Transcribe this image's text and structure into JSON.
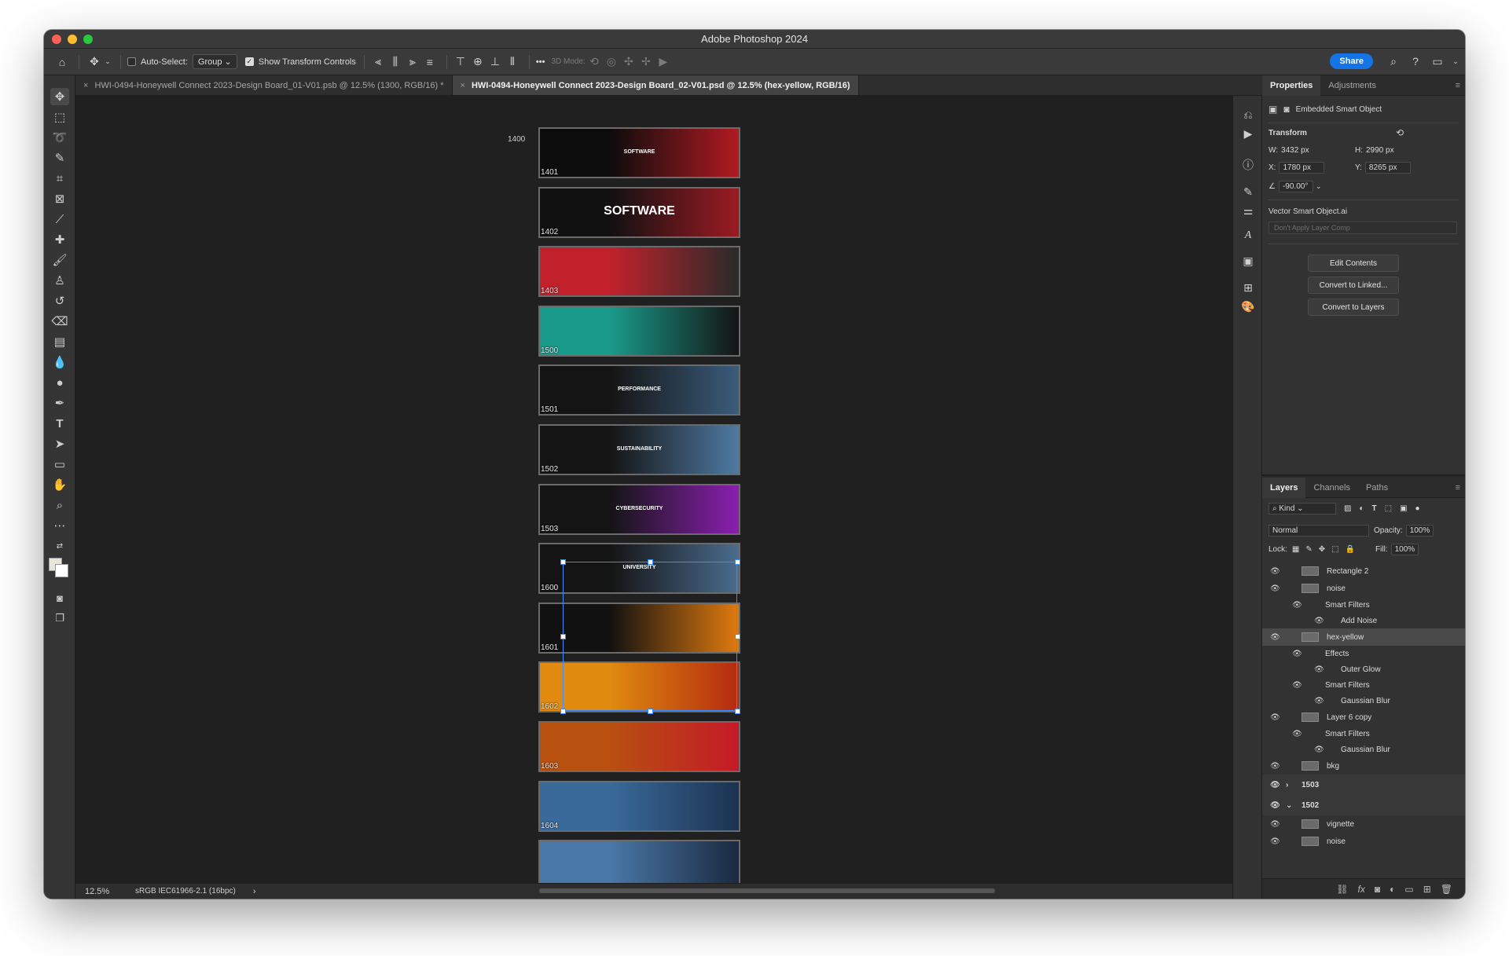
{
  "app": {
    "title": "Adobe Photoshop 2024"
  },
  "options_bar": {
    "auto_select_label": "Auto-Select:",
    "auto_select_value": "Group",
    "transform_controls_label": "Show Transform Controls",
    "mode_3d_label": "3D Mode:",
    "share_label": "Share",
    "more_label": "•••"
  },
  "tabs": [
    {
      "label": "HWI-0494-Honeywell Connect 2023-Design Board_01-V01.psb @ 12.5% (1300, RGB/16) *"
    },
    {
      "label": "HWI-0494-Honeywell Connect 2023-Design Board_02-V01.psd @ 12.5% (hex-yellow, RGB/16)"
    }
  ],
  "canvas": {
    "top_label": "1400",
    "artboards": [
      {
        "label": "1401",
        "text": "SOFTWARE",
        "color_a": "#0c0c0c",
        "color_b": "#b11a22"
      },
      {
        "label": "1402",
        "text": "SOFTWARE",
        "color_a": "#111111",
        "color_b": "#9c1a22"
      },
      {
        "label": "1403",
        "text": "",
        "color_a": "#c2212c",
        "color_b": "#2a2a2a"
      },
      {
        "label": "1500",
        "text": "",
        "color_a": "#1a9a8a",
        "color_b": "#141414"
      },
      {
        "label": "1501",
        "text": "PERFORMANCE",
        "color_a": "#141414",
        "color_b": "#3b5c7c"
      },
      {
        "label": "1502",
        "text": "SUSTAINABILITY",
        "color_a": "#141414",
        "color_b": "#4f7aa3"
      },
      {
        "label": "1503",
        "text": "CYBERSECURITY",
        "color_a": "#141414",
        "color_b": "#8a1fb0"
      },
      {
        "label": "1600",
        "text": "UNIVERSITY",
        "color_a": "#141414",
        "color_b": "#4a6c8e"
      },
      {
        "label": "1601",
        "text": "",
        "color_a": "#111111",
        "color_b": "#e07a10"
      },
      {
        "label": "1602",
        "text": "",
        "color_a": "#e08a10",
        "color_b": "#b42a10"
      },
      {
        "label": "1603",
        "text": "",
        "color_a": "#b85010",
        "color_b": "#c41a28"
      },
      {
        "label": "1604",
        "text": "",
        "color_a": "#3a6a9a",
        "color_b": "#1c3250"
      },
      {
        "label": "",
        "text": "",
        "color_a": "#4a78a8",
        "color_b": "#1a2a40"
      }
    ]
  },
  "status": {
    "zoom": "12.5%",
    "profile": "sRGB IEC61966-2.1 (16bpc)",
    "arrow": "›"
  },
  "properties": {
    "tabs": [
      "Properties",
      "Adjustments"
    ],
    "object_type": "Embedded Smart Object",
    "transform_label": "Transform",
    "w_label": "W:",
    "w_value": "3432 px",
    "h_label": "H:",
    "h_value": "2990 px",
    "x_label": "X:",
    "x_value": "1780 px",
    "y_label": "Y:",
    "y_value": "8265 px",
    "angle_value": "-90.00°",
    "source_name": "Vector Smart Object.ai",
    "layer_comp": "Don't Apply Layer Comp",
    "buttons": [
      "Edit Contents",
      "Convert to Linked...",
      "Convert to Layers"
    ]
  },
  "layers": {
    "tabs": [
      "Layers",
      "Channels",
      "Paths"
    ],
    "kind_label": "Kind",
    "blend_mode": "Normal",
    "opacity_label": "Opacity:",
    "opacity_value": "100%",
    "lock_label": "Lock:",
    "fill_label": "Fill:",
    "fill_value": "100%",
    "items": [
      {
        "name": "Rectangle 2",
        "indent": 1,
        "type": "layer"
      },
      {
        "name": "noise",
        "indent": 1,
        "type": "layer"
      },
      {
        "name": "Smart Filters",
        "indent": 2,
        "type": "sub"
      },
      {
        "name": "Add Noise",
        "indent": 3,
        "type": "sub"
      },
      {
        "name": "hex-yellow",
        "indent": 1,
        "type": "selected"
      },
      {
        "name": "Effects",
        "indent": 2,
        "type": "sub"
      },
      {
        "name": "Outer Glow",
        "indent": 3,
        "type": "sub"
      },
      {
        "name": "Smart Filters",
        "indent": 2,
        "type": "sub"
      },
      {
        "name": "Gaussian Blur",
        "indent": 3,
        "type": "sub"
      },
      {
        "name": "Layer 6 copy",
        "indent": 1,
        "type": "layer"
      },
      {
        "name": "Smart Filters",
        "indent": 2,
        "type": "sub"
      },
      {
        "name": "Gaussian Blur",
        "indent": 3,
        "type": "sub"
      },
      {
        "name": "bkg",
        "indent": 1,
        "type": "layer"
      },
      {
        "name": "1503",
        "indent": 0,
        "type": "group"
      },
      {
        "name": "1502",
        "indent": 0,
        "type": "group"
      },
      {
        "name": "vignette",
        "indent": 1,
        "type": "layer"
      },
      {
        "name": "noise",
        "indent": 1,
        "type": "layer"
      }
    ]
  }
}
